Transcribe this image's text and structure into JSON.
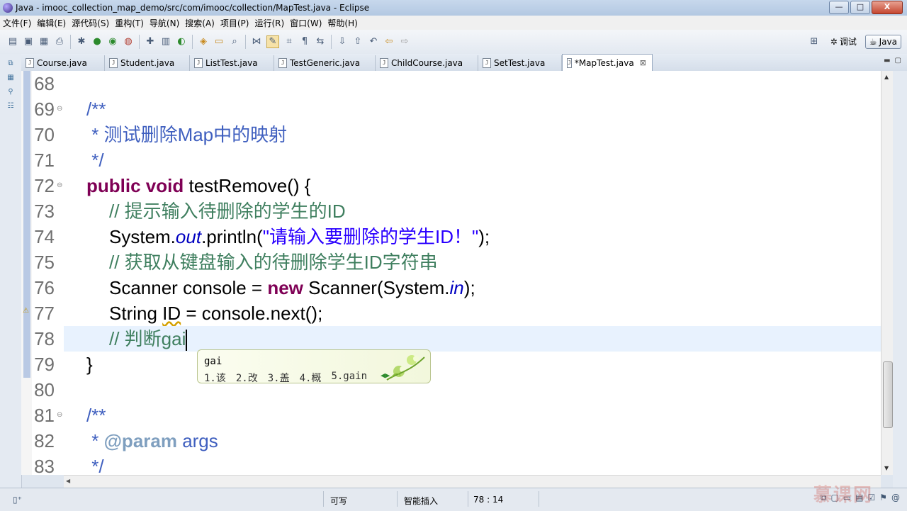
{
  "window": {
    "title": "Java - imooc_collection_map_demo/src/com/imooc/collection/MapTest.java - Eclipse",
    "controls": [
      "—",
      "□",
      "X"
    ]
  },
  "menubar": [
    "文件(F)",
    "编辑(E)",
    "源代码(S)",
    "重构(T)",
    "导航(N)",
    "搜索(A)",
    "项目(P)",
    "运行(R)",
    "窗口(W)",
    "帮助(H)"
  ],
  "perspectives": {
    "debug_label": "调试",
    "java_label": "Java"
  },
  "tabs": [
    {
      "label": "Course.java",
      "active": false
    },
    {
      "label": "Student.java",
      "active": false
    },
    {
      "label": "ListTest.java",
      "active": false
    },
    {
      "label": "TestGeneric.java",
      "active": false
    },
    {
      "label": "ChildCourse.java",
      "active": false
    },
    {
      "label": "SetTest.java",
      "active": false
    },
    {
      "label": "*MapTest.java",
      "active": true
    }
  ],
  "code_lines": [
    {
      "num": "68",
      "fold": ""
    },
    {
      "num": "69",
      "fold": "⊖",
      "segments": [
        {
          "cls": "cmt",
          "text": "/**"
        }
      ],
      "indent": 1
    },
    {
      "num": "70",
      "fold": "",
      "segments": [
        {
          "cls": "cmt",
          "text": " * 测试删除Map中的映射"
        }
      ],
      "indent": 1
    },
    {
      "num": "71",
      "fold": "",
      "segments": [
        {
          "cls": "cmt",
          "text": " */"
        }
      ],
      "indent": 1
    },
    {
      "num": "72",
      "fold": "⊖",
      "segments": [
        {
          "cls": "kw",
          "text": "public"
        },
        {
          "cls": "plain",
          "text": " "
        },
        {
          "cls": "kw",
          "text": "void"
        },
        {
          "cls": "plain",
          "text": " testRemove() {"
        }
      ],
      "indent": 1
    },
    {
      "num": "73",
      "fold": "",
      "segments": [
        {
          "cls": "slc",
          "text": "// 提示输入待删除的学生的ID"
        }
      ],
      "indent": 2
    },
    {
      "num": "74",
      "fold": "",
      "segments": [
        {
          "cls": "plain",
          "text": "System."
        },
        {
          "cls": "fld",
          "text": "out"
        },
        {
          "cls": "plain",
          "text": ".println("
        },
        {
          "cls": "str",
          "text": "\"请输入要删除的学生ID！\""
        },
        {
          "cls": "plain",
          "text": ");"
        }
      ],
      "indent": 2
    },
    {
      "num": "75",
      "fold": "",
      "segments": [
        {
          "cls": "slc",
          "text": "// 获取从键盘输入的待删除学生ID字符串"
        }
      ],
      "indent": 2
    },
    {
      "num": "76",
      "fold": "",
      "segments": [
        {
          "cls": "plain",
          "text": "Scanner console = "
        },
        {
          "cls": "kw",
          "text": "new"
        },
        {
          "cls": "plain",
          "text": " Scanner(System."
        },
        {
          "cls": "fld",
          "text": "in"
        },
        {
          "cls": "plain",
          "text": ");"
        }
      ],
      "indent": 2
    },
    {
      "num": "77",
      "fold": "",
      "segments": [
        {
          "cls": "plain",
          "text": "String "
        },
        {
          "cls": "wavy",
          "text": "ID"
        },
        {
          "cls": "plain",
          "text": " = console.next();"
        }
      ],
      "indent": 2
    },
    {
      "num": "78",
      "fold": "",
      "segments": [
        {
          "cls": "slc",
          "text": "// 判断gai"
        }
      ],
      "indent": 2,
      "current": true
    },
    {
      "num": "79",
      "fold": "",
      "segments": [
        {
          "cls": "plain",
          "text": "}"
        }
      ],
      "indent": 1
    },
    {
      "num": "80",
      "fold": ""
    },
    {
      "num": "81",
      "fold": "⊖",
      "segments": [
        {
          "cls": "cmt",
          "text": "/**"
        }
      ],
      "indent": 1
    },
    {
      "num": "82",
      "fold": "",
      "segments": [
        {
          "cls": "cmt",
          "text": " * "
        },
        {
          "cls": "tag",
          "text": "@param"
        },
        {
          "cls": "cmt",
          "text": " args"
        }
      ],
      "indent": 1
    },
    {
      "num": "83",
      "fold": "",
      "segments": [
        {
          "cls": "cmt",
          "text": " */"
        }
      ],
      "indent": 1
    }
  ],
  "ime": {
    "composition": "gai",
    "candidates": [
      "1.该",
      "2.改",
      "3.盖",
      "4.概",
      "5.gain"
    ]
  },
  "status": {
    "writable": "可写",
    "insert_mode": "智能插入",
    "position": "78 : 14"
  },
  "watermark": "慕课网"
}
